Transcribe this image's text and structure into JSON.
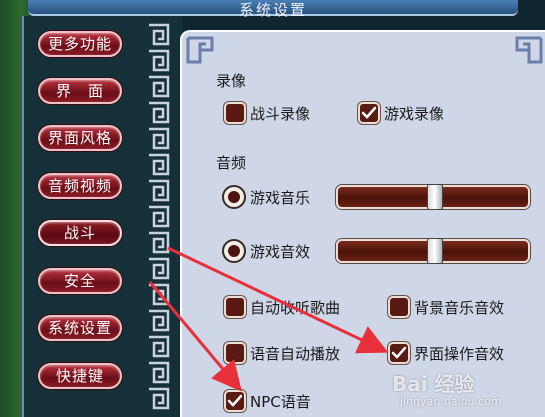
{
  "window": {
    "title": "系统设置"
  },
  "menu": [
    {
      "label": "更多功能"
    },
    {
      "label": "界　面"
    },
    {
      "label": "界面风格"
    },
    {
      "label": "音频视频"
    },
    {
      "label": "战斗",
      "active": true
    },
    {
      "label": "安全"
    },
    {
      "label": "系统设置"
    },
    {
      "label": "快捷键"
    }
  ],
  "recording": {
    "heading": "录像",
    "options": [
      {
        "label": "战斗录像",
        "checked": false
      },
      {
        "label": "游戏录像",
        "checked": true
      }
    ]
  },
  "audio": {
    "heading": "音频",
    "music": {
      "label": "游戏音乐",
      "selected": true,
      "level": 0.5
    },
    "effects": {
      "label": "游戏音效",
      "selected": true,
      "level": 0.5
    }
  },
  "options": [
    {
      "label": "自动收听歌曲",
      "checked": false
    },
    {
      "label": "背景音乐音效",
      "checked": false
    },
    {
      "label": "语音自动播放",
      "checked": false
    },
    {
      "label": "界面操作音效",
      "checked": true
    },
    {
      "label": "NPC语音",
      "checked": true
    }
  ],
  "watermark": {
    "logo": "Bai 经验",
    "url": "jingyan.baidu.com"
  },
  "colors": {
    "accent": "#8a1a24",
    "panel": "#cfd6e8",
    "arrow": "#e8303a",
    "checkbox": "#5a1a14"
  }
}
